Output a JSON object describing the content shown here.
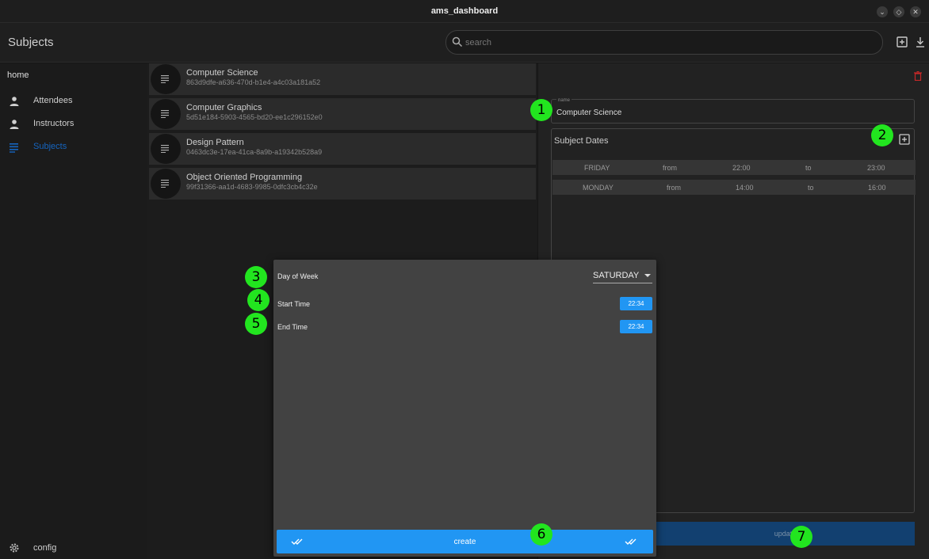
{
  "window": {
    "title": "ams_dashboard"
  },
  "appbar": {
    "title": "Subjects",
    "search_placeholder": "search"
  },
  "sidebar": {
    "home": "home",
    "items": [
      {
        "label": "Attendees",
        "icon": "person-icon",
        "active": false
      },
      {
        "label": "Instructors",
        "icon": "person-icon",
        "active": false
      },
      {
        "label": "Subjects",
        "icon": "subject-list-icon",
        "active": true
      }
    ],
    "config": "config"
  },
  "subjects": [
    {
      "name": "Computer Science",
      "id": "863d9dfe-a636-470d-b1e4-a4c03a181a52"
    },
    {
      "name": "Computer Graphics",
      "id": "5d51e184-5903-4565-bd20-ee1c296152e0"
    },
    {
      "name": "Design Pattern",
      "id": "0463dc3e-17ea-41ca-8a9b-a19342b528a9"
    },
    {
      "name": "Object Oriented Programming",
      "id": "99f31366-aa1d-4683-9985-0dfc3cb4c32e"
    }
  ],
  "detail": {
    "name_label": "name",
    "name_value": "Computer Science",
    "dates_title": "Subject Dates",
    "dates": [
      {
        "day": "FRIDAY",
        "from_label": "from",
        "start": "22:00",
        "to_label": "to",
        "end": "23:00"
      },
      {
        "day": "MONDAY",
        "from_label": "from",
        "start": "14:00",
        "to_label": "to",
        "end": "16:00"
      }
    ],
    "update_label": "update"
  },
  "dialog": {
    "day_label": "Day of Week",
    "day_value": "SATURDAY",
    "start_label": "Start Time",
    "start_value": "22:34",
    "end_label": "End Time",
    "end_value": "22:34",
    "create_label": "create"
  },
  "markers": [
    "1",
    "2",
    "3",
    "4",
    "5",
    "6",
    "7"
  ],
  "colors": {
    "accent": "#2196f3",
    "active_nav": "#1565c0",
    "marker": "#22e51f",
    "delete": "#c62828"
  }
}
